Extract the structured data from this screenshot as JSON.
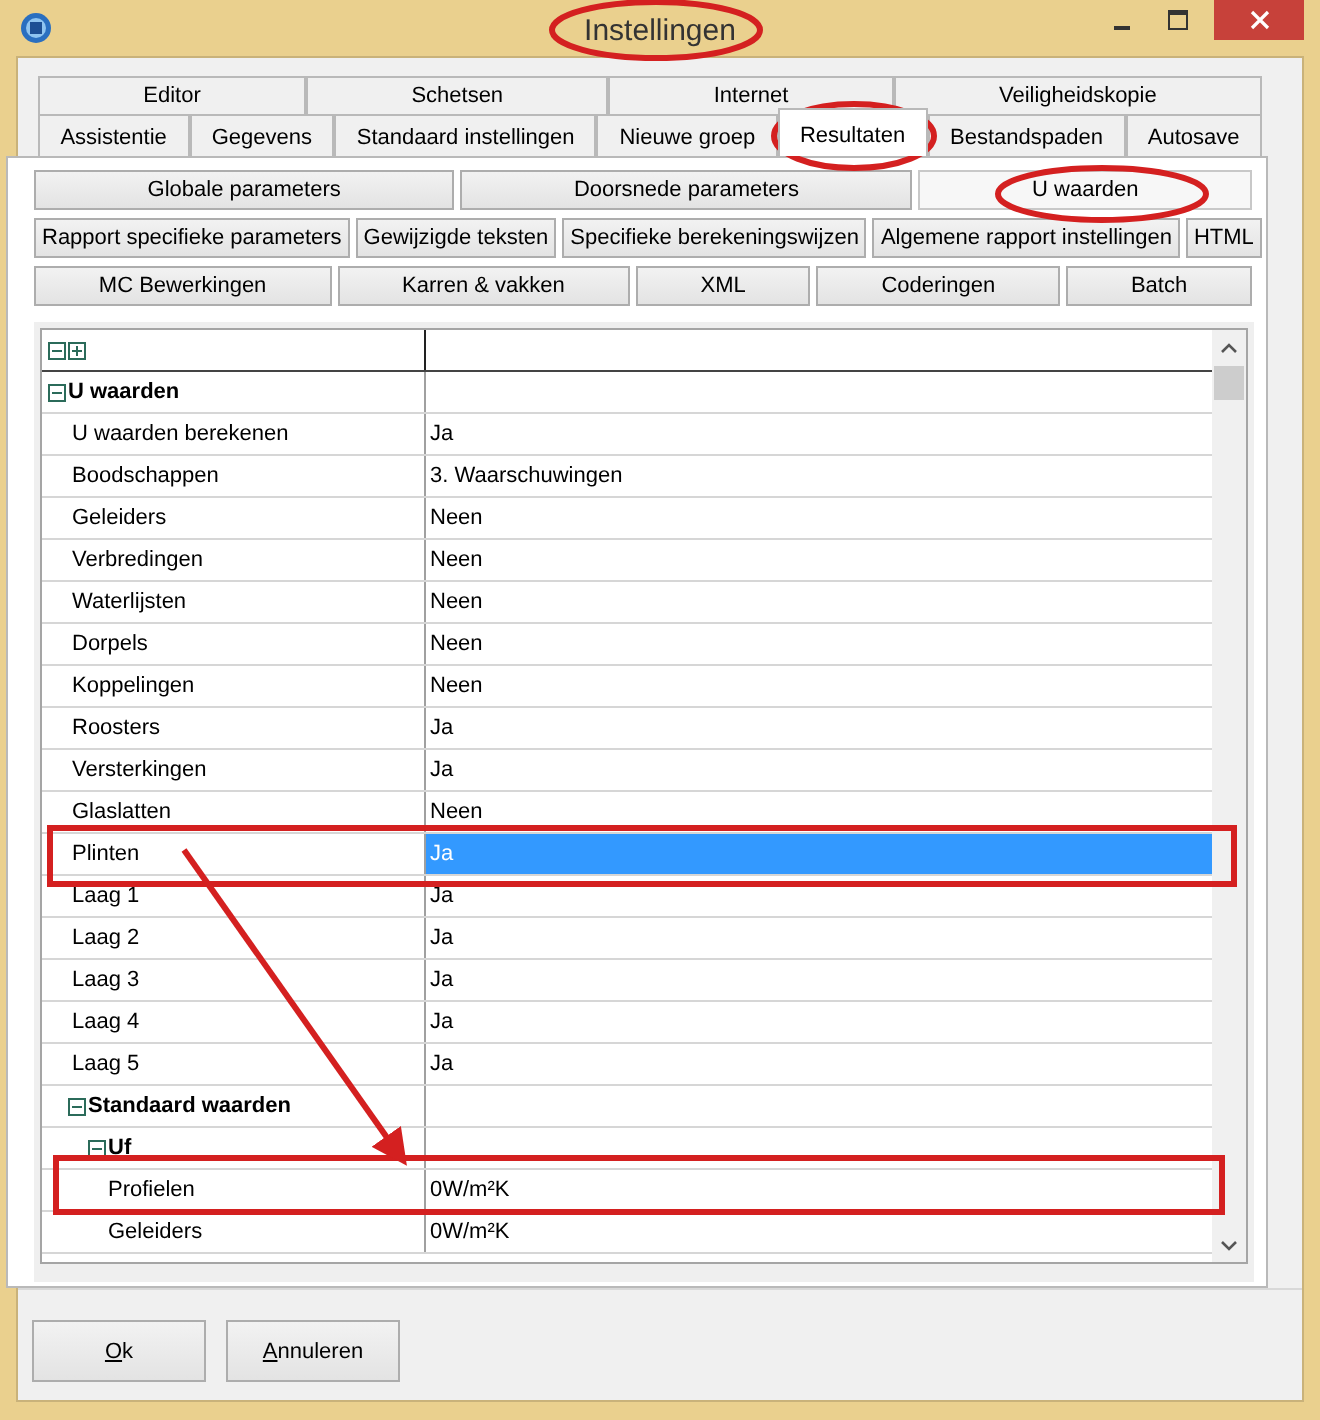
{
  "window": {
    "title": "Instellingen"
  },
  "tab_rows": [
    {
      "tabs": [
        {
          "label": "Editor",
          "selected": false
        },
        {
          "label": "Schetsen",
          "selected": false
        },
        {
          "label": "Internet",
          "selected": false
        },
        {
          "label": "Veiligheidskopie",
          "selected": false
        }
      ]
    },
    {
      "tabs": [
        {
          "label": "Assistentie",
          "selected": false
        },
        {
          "label": "Gegevens",
          "selected": false
        },
        {
          "label": "Standaard instellingen",
          "selected": false
        },
        {
          "label": "Nieuwe groep",
          "selected": false
        },
        {
          "label": "Resultaten",
          "selected": true
        },
        {
          "label": "Bestandspaden",
          "selected": false
        },
        {
          "label": "Autosave",
          "selected": false
        }
      ]
    }
  ],
  "section_rows": [
    {
      "buttons": [
        {
          "label": "Globale parameters",
          "selected": false
        },
        {
          "label": "Doorsnede parameters",
          "selected": false
        },
        {
          "label": "U waarden",
          "selected": true
        }
      ]
    },
    {
      "buttons": [
        {
          "label": "Rapport specifieke parameters",
          "selected": false
        },
        {
          "label": "Gewijzigde teksten",
          "selected": false
        },
        {
          "label": "Specifieke berekeningswijzen",
          "selected": false
        },
        {
          "label": "Algemene rapport instellingen",
          "selected": false
        },
        {
          "label": "HTML",
          "selected": false
        }
      ]
    },
    {
      "buttons": [
        {
          "label": "MC Bewerkingen",
          "selected": false
        },
        {
          "label": "Karren & vakken",
          "selected": false
        },
        {
          "label": "XML",
          "selected": false
        },
        {
          "label": "Coderingen",
          "selected": false
        },
        {
          "label": "Batch",
          "selected": false
        }
      ]
    }
  ],
  "grid": {
    "rows": [
      {
        "kind": "group",
        "name": "U waarden",
        "expanded": true,
        "children": [
          {
            "kind": "property",
            "name": "U waarden berekenen",
            "value": "Ja",
            "selected": false
          },
          {
            "kind": "property",
            "name": "Boodschappen",
            "value": "3. Waarschuwingen",
            "selected": false
          },
          {
            "kind": "property",
            "name": "Geleiders",
            "value": "Neen",
            "selected": false
          },
          {
            "kind": "property",
            "name": "Verbredingen",
            "value": "Neen",
            "selected": false
          },
          {
            "kind": "property",
            "name": "Waterlijsten",
            "value": "Neen",
            "selected": false
          },
          {
            "kind": "property",
            "name": "Dorpels",
            "value": "Neen",
            "selected": false
          },
          {
            "kind": "property",
            "name": "Koppelingen",
            "value": "Neen",
            "selected": false
          },
          {
            "kind": "property",
            "name": "Roosters",
            "value": "Ja",
            "selected": false
          },
          {
            "kind": "property",
            "name": "Versterkingen",
            "value": "Ja",
            "selected": false
          },
          {
            "kind": "property",
            "name": "Glaslatten",
            "value": "Neen",
            "selected": false
          },
          {
            "kind": "property",
            "name": "Plinten",
            "value": "Ja",
            "selected": true
          },
          {
            "kind": "property",
            "name": "Laag 1",
            "value": "Ja",
            "selected": false
          },
          {
            "kind": "property",
            "name": "Laag 2",
            "value": "Ja",
            "selected": false
          },
          {
            "kind": "property",
            "name": "Laag 3",
            "value": "Ja",
            "selected": false
          },
          {
            "kind": "property",
            "name": "Laag 4",
            "value": "Ja",
            "selected": false
          },
          {
            "kind": "property",
            "name": "Laag 5",
            "value": "Ja",
            "selected": false
          },
          {
            "kind": "group",
            "name": "Standaard waarden",
            "expanded": true,
            "children": [
              {
                "kind": "group",
                "name": "Uf",
                "expanded": true,
                "children": [
                  {
                    "kind": "property",
                    "name": "Profielen",
                    "value": "0W/m²K",
                    "selected": false
                  },
                  {
                    "kind": "property",
                    "name": "Geleiders",
                    "value": "0W/m²K",
                    "selected": false
                  }
                ]
              }
            ]
          }
        ]
      }
    ]
  },
  "buttons": [
    {
      "access_key": "O",
      "rest": "k"
    },
    {
      "access_key": "A",
      "rest": "nnuleren"
    }
  ]
}
